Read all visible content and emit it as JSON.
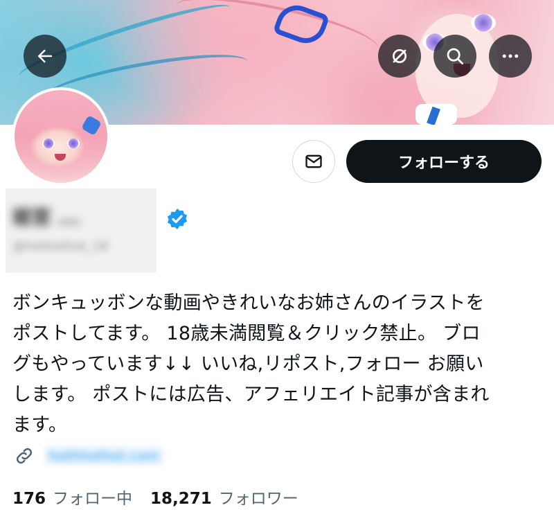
{
  "header": {
    "back_icon": "arrow-left-icon",
    "refresh_icon": "refresh-icon",
    "search_icon": "search-icon",
    "more_icon": "more-horizontal-icon"
  },
  "profile": {
    "display_name": "姫宮 ... ",
    "handle": "@hothothot_18",
    "verified": true,
    "follow_button_label": "フォローする",
    "message_icon": "mail-icon",
    "bio": "ボンキュッボンな動画やきれいなお姉さんのイラストを\nポストしてます。 18歳未満閲覧＆クリック禁止。 ブロ\nグもやっています↓↓ いいね,リポスト,フォロー お願い\nします。 ポストには広告、アフェリエイト記事が含まれ\nます。",
    "link_text": "hothhothot.com",
    "following_count": "176",
    "following_label": "フォロー中",
    "followers_count": "18,271",
    "followers_label": "フォロワー"
  },
  "colors": {
    "accent": "#1d9bf0",
    "primary_button": "#0f1419",
    "secondary_text": "#536471"
  }
}
